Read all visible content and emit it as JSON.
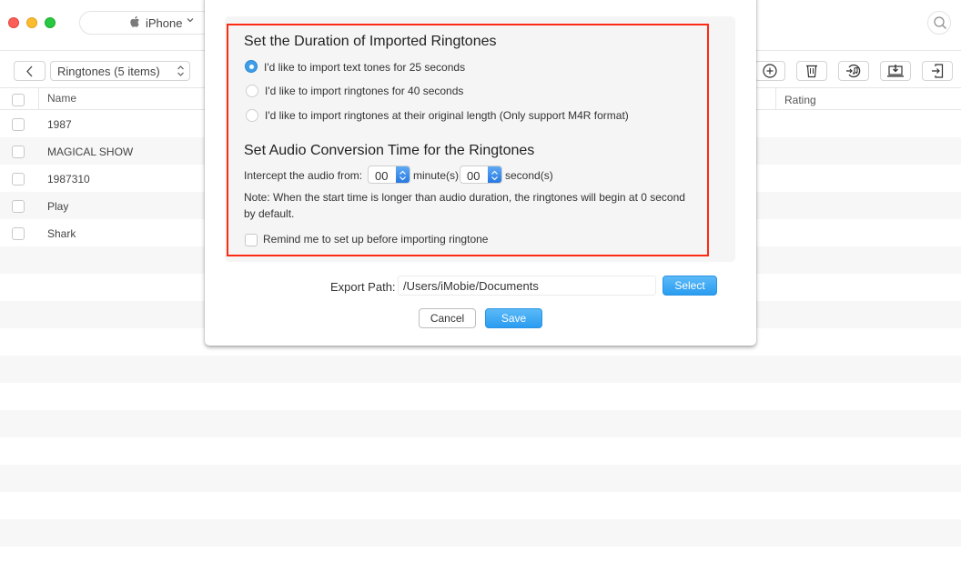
{
  "window": {
    "device_name": "iPhone",
    "device_icon": "apple-icon"
  },
  "toolbar": {
    "category_select": "Ringtones (5 items)",
    "actions": [
      {
        "name": "add",
        "icon": "plus-circle-icon"
      },
      {
        "name": "delete",
        "icon": "trash-icon"
      },
      {
        "name": "add-to-itunes",
        "icon": "music-import-icon"
      },
      {
        "name": "send-to-computer",
        "icon": "download-to-computer-icon"
      },
      {
        "name": "send-to-device",
        "icon": "import-to-device-icon"
      }
    ]
  },
  "table": {
    "columns": [
      "Name",
      "Rating"
    ],
    "rows": [
      {
        "name": "1987"
      },
      {
        "name": "MAGICAL SHOW"
      },
      {
        "name": "1987310"
      },
      {
        "name": "Play"
      },
      {
        "name": "Shark"
      }
    ]
  },
  "dialog": {
    "duration_title": "Set the Duration of Imported Ringtones",
    "duration_options": [
      {
        "label": "I'd like to import text tones for 25 seconds",
        "selected": true
      },
      {
        "label": "I'd like to import ringtones for 40 seconds",
        "selected": false
      },
      {
        "label": "I'd like to import ringtones at their original length (Only support M4R format)",
        "selected": false
      }
    ],
    "conversion_title": "Set Audio Conversion Time for the Ringtones",
    "intercept_label": "Intercept the audio from:",
    "minutes_value": "00",
    "minutes_unit": "minute(s)",
    "seconds_value": "00",
    "seconds_unit": "second(s)",
    "note_line1": "Note: When the start time is longer than audio duration, the ringtones will begin at 0 second",
    "note_line2": "by default.",
    "remind_label": "Remind me to set up before importing ringtone",
    "remind_checked": false,
    "export_label": "Export Path:",
    "export_path": "/Users/iMobie/Documents",
    "select_button": "Select",
    "cancel_button": "Cancel",
    "save_button": "Save",
    "highlight_color": "#ff2a14",
    "accent_color": "#2a9cf0"
  }
}
